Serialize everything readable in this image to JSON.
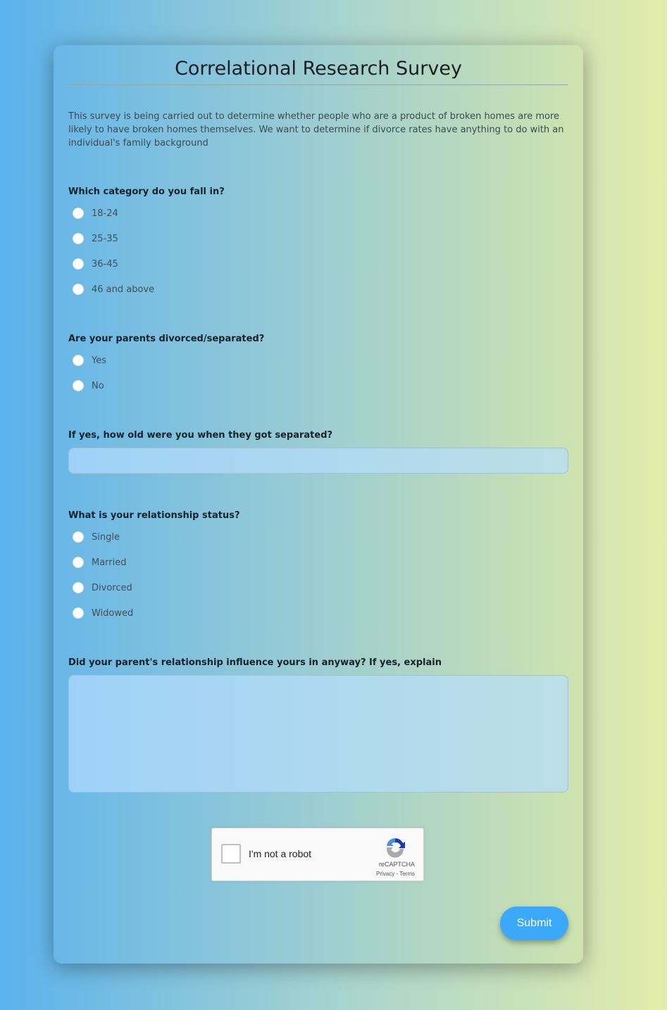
{
  "title": "Correlational Research Survey",
  "description": "This survey is being carried out to determine whether people who are a product of broken homes are more likely to have broken homes themselves. We want to determine if divorce rates have anything to do with an individual's family background",
  "questions": {
    "age": {
      "label": "Which category do you fall in?",
      "options": [
        "18-24",
        "25-35",
        "36-45",
        "46 and above"
      ]
    },
    "parents": {
      "label": "Are your parents divorced/separated?",
      "options": [
        "Yes",
        "No"
      ]
    },
    "age_separated": {
      "label": "If yes, how old were you when they got separated?",
      "value": ""
    },
    "status": {
      "label": "What is your relationship status?",
      "options": [
        "Single",
        "Married",
        "Divorced",
        "Widowed"
      ]
    },
    "influence": {
      "label": "Did your parent's relationship influence yours in anyway? If yes, explain",
      "value": ""
    }
  },
  "captcha": {
    "label": "I'm not a robot",
    "brand": "reCAPTCHA",
    "privacy": "Privacy",
    "terms": "Terms",
    "icon": "recaptcha-icon"
  },
  "submit_label": "Submit",
  "colors": {
    "accent": "#3ba8f8"
  }
}
